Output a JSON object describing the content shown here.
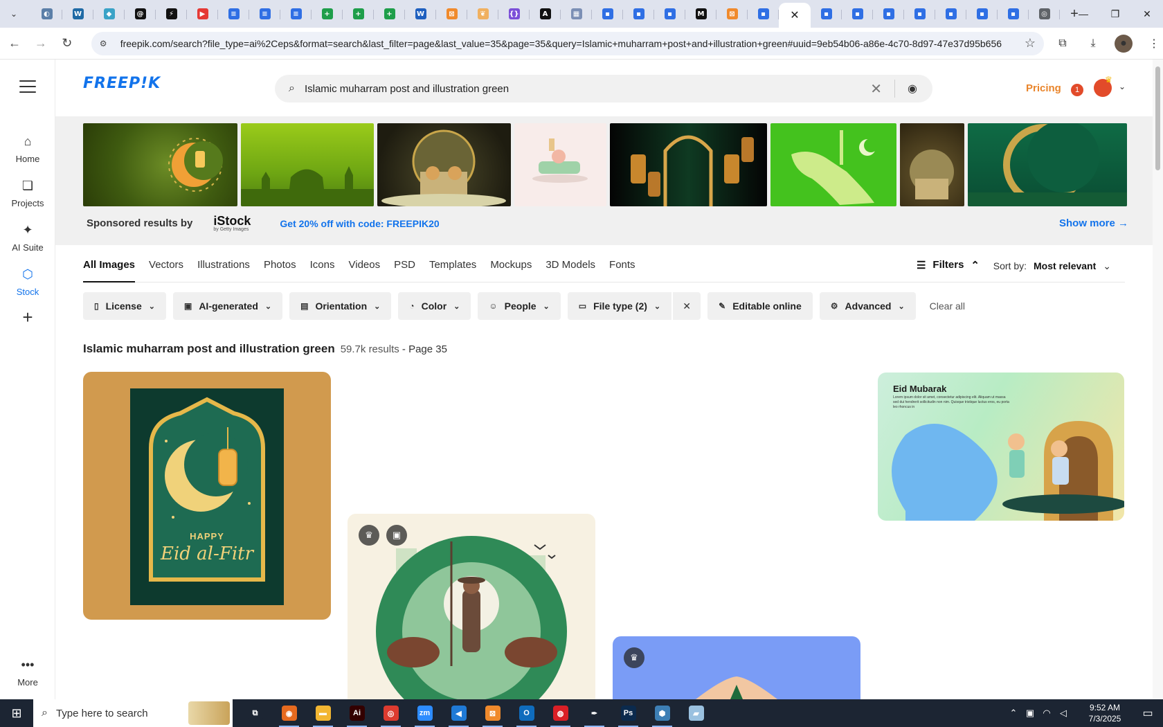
{
  "browser": {
    "tabs": [
      {
        "icon": "globe-favicon",
        "color": "#5b7fa8",
        "glyph": "◐"
      },
      {
        "icon": "wp-favicon",
        "color": "#1f6aa5",
        "glyph": "W"
      },
      {
        "icon": "diamond-favicon",
        "color": "#3aa3c7",
        "glyph": "◆"
      },
      {
        "icon": "threads-favicon",
        "color": "#111111",
        "glyph": "@"
      },
      {
        "icon": "bolt-favicon",
        "color": "#111111",
        "glyph": "⚡"
      },
      {
        "icon": "youtube-favicon",
        "color": "#e53935",
        "glyph": "▶"
      },
      {
        "icon": "docs-favicon",
        "color": "#2f6fe4",
        "glyph": "≡"
      },
      {
        "icon": "docs-favicon",
        "color": "#2f6fe4",
        "glyph": "≡"
      },
      {
        "icon": "docs-favicon",
        "color": "#2f6fe4",
        "glyph": "≡"
      },
      {
        "icon": "sheets-favicon",
        "color": "#1e9e4a",
        "glyph": "+"
      },
      {
        "icon": "sheets-favicon",
        "color": "#1e9e4a",
        "glyph": "+"
      },
      {
        "icon": "sheets-favicon",
        "color": "#1e9e4a",
        "glyph": "+"
      },
      {
        "icon": "word-favicon",
        "color": "#1e5fbf",
        "glyph": "W"
      },
      {
        "icon": "xampp-favicon",
        "color": "#f08a2c",
        "glyph": "⊠"
      },
      {
        "icon": "bird-favicon",
        "color": "#f0b060",
        "glyph": "❦"
      },
      {
        "icon": "code-favicon",
        "color": "#7b4fd8",
        "glyph": "{}"
      },
      {
        "icon": "a-favicon",
        "color": "#111111",
        "glyph": "A"
      },
      {
        "icon": "grid-favicon",
        "color": "#7b8fb5",
        "glyph": "▦"
      },
      {
        "icon": "forms-favicon",
        "color": "#2f6fe4",
        "glyph": "▪"
      },
      {
        "icon": "forms-favicon",
        "color": "#2f6fe4",
        "glyph": "▪"
      },
      {
        "icon": "forms-favicon",
        "color": "#2f6fe4",
        "glyph": "▪"
      },
      {
        "icon": "m-favicon",
        "color": "#111111",
        "glyph": "M"
      },
      {
        "icon": "xampp-favicon",
        "color": "#f08a2c",
        "glyph": "⊠"
      },
      {
        "icon": "forms-favicon",
        "color": "#2f6fe4",
        "glyph": "▪"
      }
    ],
    "tabs_after": [
      {
        "icon": "forms-favicon",
        "color": "#2f6fe4",
        "glyph": "▪"
      },
      {
        "icon": "forms-favicon",
        "color": "#2f6fe4",
        "glyph": "▪"
      },
      {
        "icon": "forms-favicon",
        "color": "#2f6fe4",
        "glyph": "▪"
      },
      {
        "icon": "forms-favicon",
        "color": "#2f6fe4",
        "glyph": "▪"
      },
      {
        "icon": "forms-favicon",
        "color": "#2f6fe4",
        "glyph": "▪"
      },
      {
        "icon": "forms-favicon",
        "color": "#2f6fe4",
        "glyph": "▪"
      },
      {
        "icon": "forms-favicon",
        "color": "#2f6fe4",
        "glyph": "▪"
      },
      {
        "icon": "chrome-favicon",
        "color": "#5f6368",
        "glyph": "◎"
      }
    ],
    "url": "freepik.com/search?file_type=ai%2Ceps&format=search&last_filter=page&last_value=35&page=35&query=Islamic+muharram+post+and+illustration+green#uuid=9eb54b06-a86e-4c70-8d97-47e37d95b656"
  },
  "rail": {
    "items": [
      {
        "label": "Home",
        "icon": "home-icon"
      },
      {
        "label": "Projects",
        "icon": "projects-icon"
      },
      {
        "label": "AI Suite",
        "icon": "sparkle-icon"
      },
      {
        "label": "Stock",
        "icon": "stock-icon"
      }
    ],
    "more_label": "More"
  },
  "header": {
    "logo": "FREEP!K",
    "search_value": "Islamic muharram post and illustration green",
    "pricing": "Pricing",
    "notif_count": "1"
  },
  "sponsored": {
    "by_label": "Sponsored results by",
    "provider": "iStock",
    "provider_sub": "by Getty Images",
    "promo": "Get 20% off with code: FREEPIK20",
    "show_more": "Show more →"
  },
  "type_tabs": [
    "All Images",
    "Vectors",
    "Illustrations",
    "Photos",
    "Icons",
    "Videos",
    "PSD",
    "Templates",
    "Mockups",
    "3D Models",
    "Fonts"
  ],
  "filters_label": "Filters",
  "sort": {
    "label": "Sort by:",
    "value": "Most relevant"
  },
  "filter_chips": {
    "license": "License",
    "ai": "AI-generated",
    "orientation": "Orientation",
    "color": "Color",
    "people": "People",
    "filetype": "File type (2)",
    "editable": "Editable online",
    "advanced": "Advanced",
    "clear_all": "Clear all"
  },
  "results": {
    "query": "Islamic muharram post and illustration green",
    "count": "59.7k results",
    "page": "- Page 35"
  },
  "cards": {
    "eid_fitr_happy": "HAPPY",
    "eid_fitr_title": "Eid al-Fitr",
    "eid_mubarak_title": "Eid Mubarak",
    "eid_mubarak_body": "Lorem ipsum dolor sit amet, consectetur adipiscing elit. Aliquam ut massa sed dui hendrerit sollicitudin non nim. Quisque tristique luctus eros, eu porta leo rhoncus in"
  },
  "taskbar": {
    "search_placeholder": "Type here to search",
    "time": "9:52 AM",
    "date": "7/3/2025",
    "apps": [
      {
        "name": "task-view",
        "color": "#1c2533",
        "glyph": "⧉"
      },
      {
        "name": "firefox",
        "color": "#e66a1f",
        "glyph": "◉"
      },
      {
        "name": "file-explorer",
        "color": "#f2b632",
        "glyph": "▬"
      },
      {
        "name": "illustrator",
        "color": "#330000",
        "glyph": "Ai"
      },
      {
        "name": "chrome",
        "color": "#dd3b2f",
        "glyph": "◎"
      },
      {
        "name": "zoom",
        "color": "#2d8cff",
        "glyph": "zm"
      },
      {
        "name": "vscode",
        "color": "#1f7ad6",
        "glyph": "◀"
      },
      {
        "name": "xampp",
        "color": "#f08a2c",
        "glyph": "⊠"
      },
      {
        "name": "outlook",
        "color": "#0f6cbd",
        "glyph": "O"
      },
      {
        "name": "creative-cloud",
        "color": "#da1f26",
        "glyph": "◍"
      },
      {
        "name": "pen-tool",
        "color": "#1c2533",
        "glyph": "✒"
      },
      {
        "name": "photoshop",
        "color": "#0b2a4d",
        "glyph": "Ps"
      },
      {
        "name": "hex-app",
        "color": "#3d7fb5",
        "glyph": "⬢"
      },
      {
        "name": "notes-app",
        "color": "#9ac1e0",
        "glyph": "▰"
      }
    ]
  },
  "colors": {
    "brand_blue": "#1273eb",
    "pricing_orange": "#e9852b",
    "chip_bg": "#f0f0f0"
  }
}
